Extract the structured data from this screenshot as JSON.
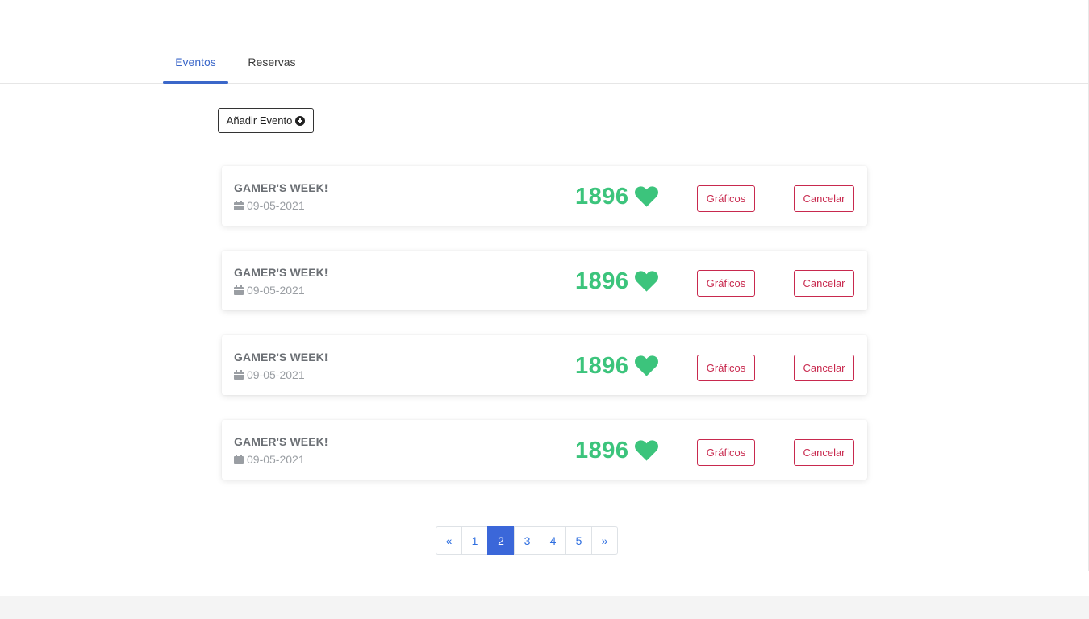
{
  "tabs": [
    {
      "label": "Eventos",
      "active": true
    },
    {
      "label": "Reservas",
      "active": false
    }
  ],
  "add_event": {
    "label": "Añadir Evento",
    "icon": "plus-circle-icon"
  },
  "events": [
    {
      "title": "GAMER'S WEEK!",
      "date": "09-05-2021",
      "likes": "1896",
      "graphs_label": "Gráficos",
      "cancel_label": "Cancelar"
    },
    {
      "title": "GAMER'S WEEK!",
      "date": "09-05-2021",
      "likes": "1896",
      "graphs_label": "Gráficos",
      "cancel_label": "Cancelar"
    },
    {
      "title": "GAMER'S WEEK!",
      "date": "09-05-2021",
      "likes": "1896",
      "graphs_label": "Gráficos",
      "cancel_label": "Cancelar"
    },
    {
      "title": "GAMER'S WEEK!",
      "date": "09-05-2021",
      "likes": "1896",
      "graphs_label": "Gráficos",
      "cancel_label": "Cancelar"
    }
  ],
  "pagination": {
    "prev": "«",
    "pages": [
      "1",
      "2",
      "3",
      "4",
      "5"
    ],
    "active_page": "2",
    "next": "»"
  },
  "colors": {
    "accent": "#3b67c9",
    "likes": "#3cc47c",
    "danger": "#c8294e",
    "page_active": "#3b67d9"
  }
}
